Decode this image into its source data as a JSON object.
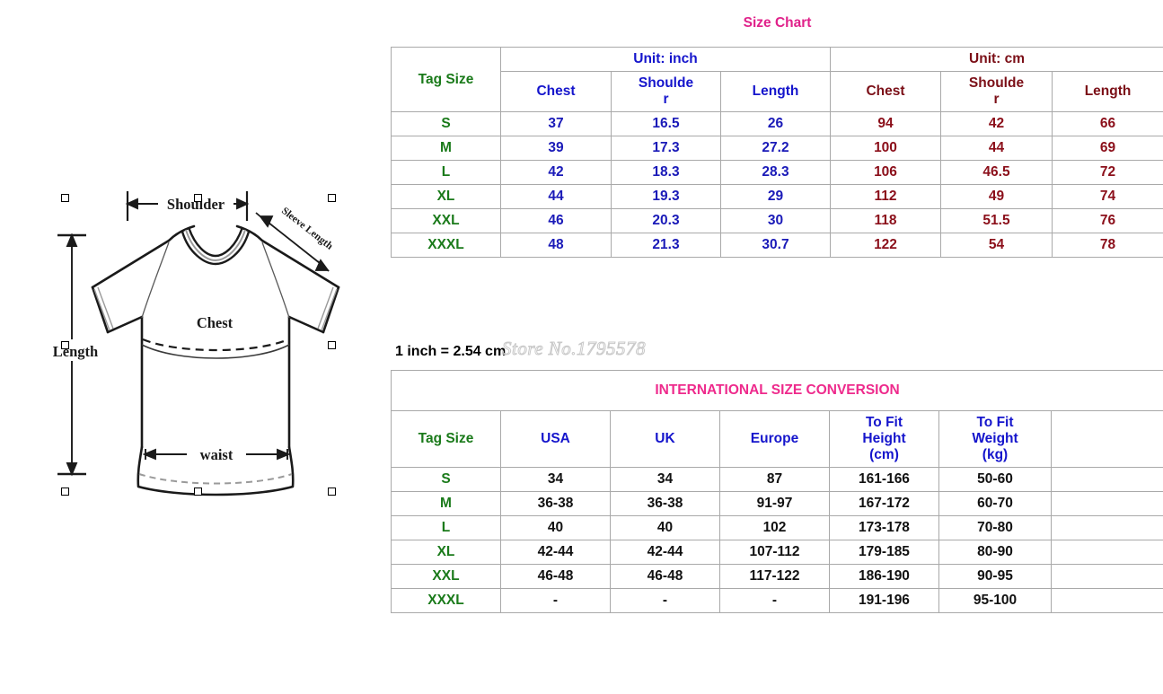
{
  "figure": {
    "alt": "t-shirt measurement diagram",
    "labels": {
      "shoulder": "Shoulder",
      "sleeve_length": "Sleeve Length",
      "chest": "Chest",
      "length": "Length",
      "waist": "waist"
    }
  },
  "size_chart": {
    "title": "Size Chart",
    "tag_size_header": "Tag Size",
    "unit_inch": "Unit: inch",
    "unit_cm": "Unit: cm",
    "columns": {
      "chest": "Chest",
      "shoulder_line1": "Shoulde",
      "shoulder_line2": "r",
      "length": "Length"
    },
    "rows": [
      {
        "tag": "S",
        "in_chest": "37",
        "in_shoulder": "16.5",
        "in_length": "26",
        "cm_chest": "94",
        "cm_shoulder": "42",
        "cm_length": "66"
      },
      {
        "tag": "M",
        "in_chest": "39",
        "in_shoulder": "17.3",
        "in_length": "27.2",
        "cm_chest": "100",
        "cm_shoulder": "44",
        "cm_length": "69"
      },
      {
        "tag": "L",
        "in_chest": "42",
        "in_shoulder": "18.3",
        "in_length": "28.3",
        "cm_chest": "106",
        "cm_shoulder": "46.5",
        "cm_length": "72"
      },
      {
        "tag": "XL",
        "in_chest": "44",
        "in_shoulder": "19.3",
        "in_length": "29",
        "cm_chest": "112",
        "cm_shoulder": "49",
        "cm_length": "74"
      },
      {
        "tag": "XXL",
        "in_chest": "46",
        "in_shoulder": "20.3",
        "in_length": "30",
        "cm_chest": "118",
        "cm_shoulder": "51.5",
        "cm_length": "76"
      },
      {
        "tag": "XXXL",
        "in_chest": "48",
        "in_shoulder": "21.3",
        "in_length": "30.7",
        "cm_chest": "122",
        "cm_shoulder": "54",
        "cm_length": "78"
      }
    ]
  },
  "note": {
    "conversion": "1 inch = 2.54 cm",
    "watermark": "Store No.1795578"
  },
  "intl_chart": {
    "title": "INTERNATIONAL SIZE CONVERSION",
    "tag_size_header": "Tag Size",
    "columns": {
      "usa": "USA",
      "uk": "UK",
      "europe": "Europe",
      "height_line1": "To Fit",
      "height_line2": "Height",
      "height_line3": "(cm)",
      "weight_line1": "To Fit",
      "weight_line2": "Weight",
      "weight_line3": "(kg)"
    },
    "rows": [
      {
        "tag": "S",
        "usa": "34",
        "uk": "34",
        "europe": "87",
        "height": "161-166",
        "weight": "50-60"
      },
      {
        "tag": "M",
        "usa": "36-38",
        "uk": "36-38",
        "europe": "91-97",
        "height": "167-172",
        "weight": "60-70"
      },
      {
        "tag": "L",
        "usa": "40",
        "uk": "40",
        "europe": "102",
        "height": "173-178",
        "weight": "70-80"
      },
      {
        "tag": "XL",
        "usa": "42-44",
        "uk": "42-44",
        "europe": "107-112",
        "height": "179-185",
        "weight": "80-90"
      },
      {
        "tag": "XXL",
        "usa": "46-48",
        "uk": "46-48",
        "europe": "117-122",
        "height": "186-190",
        "weight": "90-95"
      },
      {
        "tag": "XXXL",
        "usa": "-",
        "uk": "-",
        "europe": "-",
        "height": "191-196",
        "weight": "95-100"
      }
    ]
  },
  "colors": {
    "title_pink": "#e0218a",
    "tag_green": "#1a7a1a",
    "inch_blue": "#1515cc",
    "cm_maroon": "#8b0f1a",
    "black": "#111111",
    "border_gray": "#a9a9a9"
  }
}
